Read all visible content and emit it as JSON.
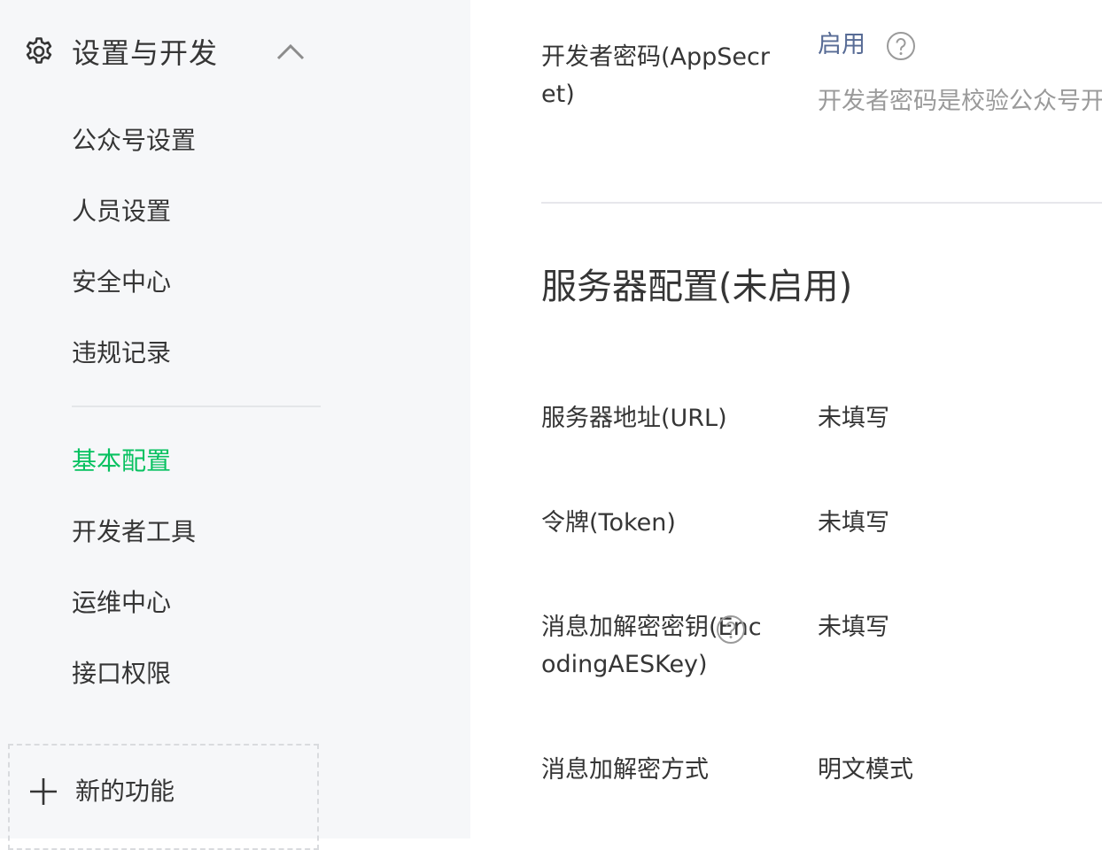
{
  "sidebar": {
    "group_title": "设置与开发",
    "items": [
      {
        "label": "公众号设置"
      },
      {
        "label": "人员设置"
      },
      {
        "label": "安全中心"
      },
      {
        "label": "违规记录"
      },
      {
        "label": "基本配置",
        "active": true
      },
      {
        "label": "开发者工具"
      },
      {
        "label": "运维中心"
      },
      {
        "label": "接口权限"
      }
    ],
    "new_feature_label": "新的功能"
  },
  "main": {
    "appsecret": {
      "label": "开发者密码(AppSecret)",
      "value": "启用",
      "description": "开发者密码是校验公众号开"
    },
    "server_config": {
      "title": "服务器配置(未启用)",
      "rows": [
        {
          "label": "服务器地址(URL)",
          "value": "未填写"
        },
        {
          "label": "令牌(Token)",
          "value": "未填写"
        },
        {
          "label": "消息加解密密钥(EncodingAESKey)",
          "value": "未填写"
        },
        {
          "label": "消息加解密方式",
          "value": "明文模式"
        }
      ]
    }
  },
  "colors": {
    "accent_green": "#07c160",
    "link_blue": "#576b95",
    "text": "#353535",
    "muted": "#9a9a9a",
    "sidebar_bg": "#f6f7f9"
  }
}
